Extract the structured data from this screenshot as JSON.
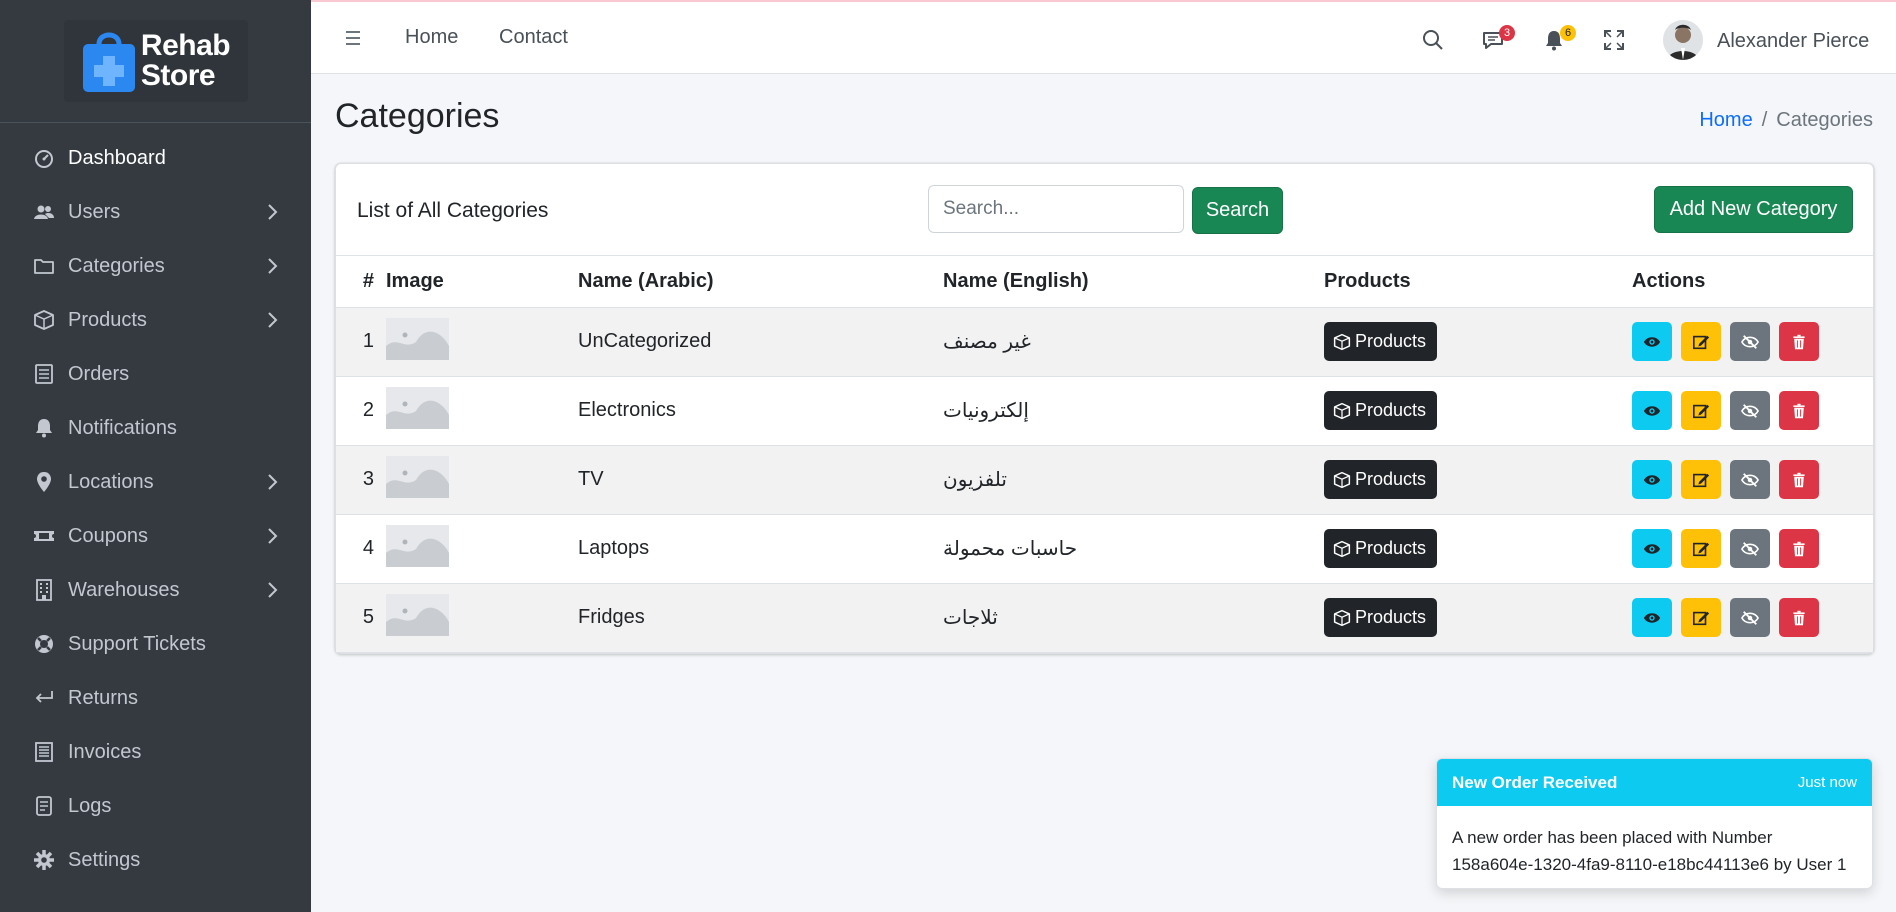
{
  "brand": {
    "line1": "Rehab",
    "line2": "Store"
  },
  "sidebar": {
    "items": [
      {
        "label": "Dashboard",
        "icon": "gauge-icon",
        "has_children": false,
        "active": true
      },
      {
        "label": "Users",
        "icon": "users-icon",
        "has_children": true
      },
      {
        "label": "Categories",
        "icon": "folder-icon",
        "has_children": true
      },
      {
        "label": "Products",
        "icon": "box-icon",
        "has_children": true
      },
      {
        "label": "Orders",
        "icon": "list-icon",
        "has_children": false
      },
      {
        "label": "Notifications",
        "icon": "bell-icon",
        "has_children": false
      },
      {
        "label": "Locations",
        "icon": "map-pin-icon",
        "has_children": true
      },
      {
        "label": "Coupons",
        "icon": "ticket-icon",
        "has_children": true
      },
      {
        "label": "Warehouses",
        "icon": "building-icon",
        "has_children": true
      },
      {
        "label": "Support Tickets",
        "icon": "life-ring-icon",
        "has_children": false
      },
      {
        "label": "Returns",
        "icon": "return-arrow-icon",
        "has_children": false
      },
      {
        "label": "Invoices",
        "icon": "invoice-icon",
        "has_children": false
      },
      {
        "label": "Logs",
        "icon": "log-icon",
        "has_children": false
      },
      {
        "label": "Settings",
        "icon": "gear-icon",
        "has_children": false
      }
    ]
  },
  "header": {
    "links": {
      "home": "Home",
      "contact": "Contact"
    },
    "messages_count": "3",
    "notifications_count": "6",
    "user_name": "Alexander Pierce"
  },
  "page": {
    "title": "Categories",
    "breadcrumb": {
      "home": "Home",
      "separator": "/",
      "current": "Categories"
    }
  },
  "card": {
    "title": "List of All Categories",
    "search_placeholder": "Search...",
    "search_button": "Search",
    "add_button": "Add New Category"
  },
  "table": {
    "headers": {
      "num": "#",
      "image": "Image",
      "name_ar": "Name (Arabic)",
      "name_en": "Name (English)",
      "products": "Products",
      "actions": "Actions"
    },
    "products_button": "Products",
    "rows": [
      {
        "num": "1",
        "name_ar": "UnCategorized",
        "name_en": "غير مصنف"
      },
      {
        "num": "2",
        "name_ar": "Electronics",
        "name_en": "إلكترونيات"
      },
      {
        "num": "3",
        "name_ar": "TV",
        "name_en": "تلفزيون"
      },
      {
        "num": "4",
        "name_ar": "Laptops",
        "name_en": "حاسبات محمولة"
      },
      {
        "num": "5",
        "name_ar": "Fridges",
        "name_en": "ثلاجات"
      }
    ]
  },
  "toast": {
    "title": "New Order Received",
    "time": "Just now",
    "body_line1": "A new order has been placed with Number",
    "body_line2": "158a604e-1320-4fa9-8110-e18bc44113e6 by User 1"
  },
  "colors": {
    "sidebar_bg": "#343a40",
    "success": "#198754",
    "info": "#0dcaf0",
    "warning": "#ffc107",
    "danger": "#dc3545",
    "secondary": "#6c757d",
    "dark": "#212529",
    "link": "#0d6efd"
  }
}
